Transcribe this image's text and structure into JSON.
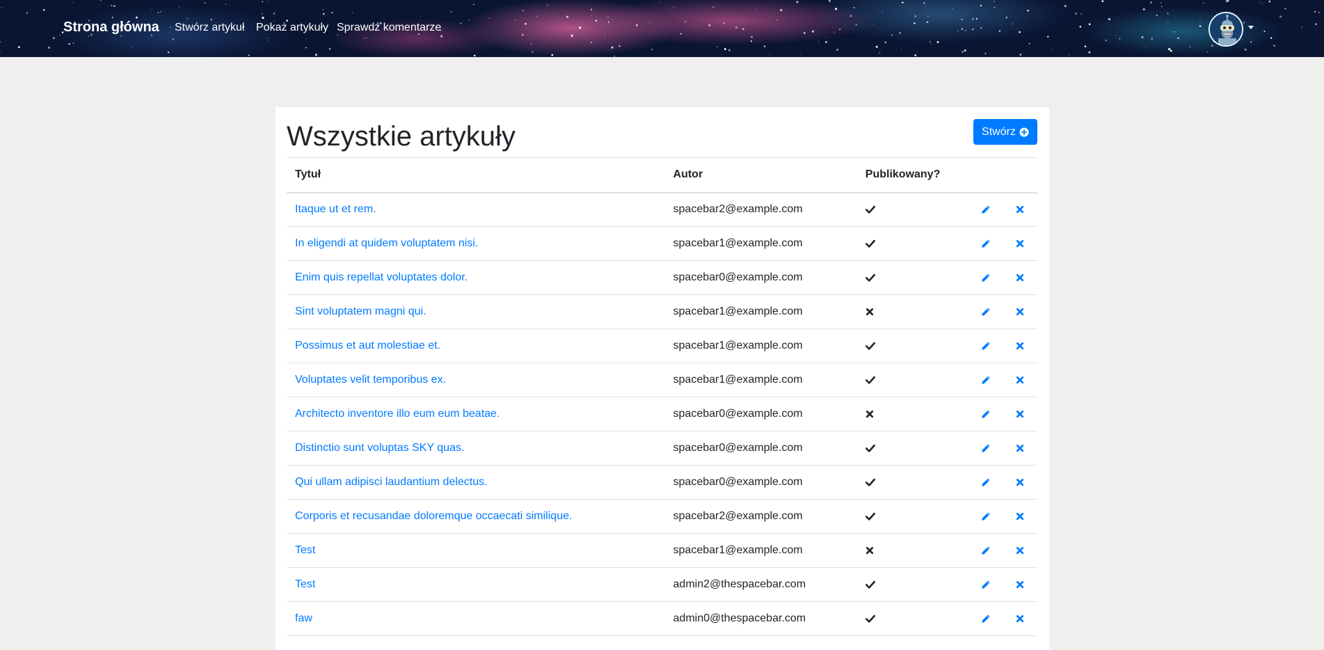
{
  "navbar": {
    "brand": "Strona główna",
    "links": [
      "Stwórz artykuł",
      "Pokaż artykuły",
      "Sprawdź komentarze"
    ]
  },
  "page": {
    "title": "Wszystkie artykuły",
    "create_button": "Stwórz"
  },
  "table": {
    "headers": [
      "Tytuł",
      "Autor",
      "Publikowany?"
    ],
    "rows": [
      {
        "title": "Itaque ut et rem.",
        "author": "spacebar2@example.com",
        "published": true
      },
      {
        "title": "In eligendi at quidem voluptatem nisi.",
        "author": "spacebar1@example.com",
        "published": true
      },
      {
        "title": "Enim quis repellat voluptates dolor.",
        "author": "spacebar0@example.com",
        "published": true
      },
      {
        "title": "Sint voluptatem magni qui.",
        "author": "spacebar1@example.com",
        "published": false
      },
      {
        "title": "Possimus et aut molestiae et.",
        "author": "spacebar1@example.com",
        "published": true
      },
      {
        "title": "Voluptates velit temporibus ex.",
        "author": "spacebar1@example.com",
        "published": true
      },
      {
        "title": "Architecto inventore illo eum eum beatae.",
        "author": "spacebar0@example.com",
        "published": false
      },
      {
        "title": "Distinctio sunt voluptas SKY quas.",
        "author": "spacebar0@example.com",
        "published": true
      },
      {
        "title": "Qui ullam adipisci laudantium delectus.",
        "author": "spacebar0@example.com",
        "published": true
      },
      {
        "title": "Corporis et recusandae doloremque occaecati similique.",
        "author": "spacebar2@example.com",
        "published": true
      },
      {
        "title": "Test",
        "author": "spacebar1@example.com",
        "published": false
      },
      {
        "title": "Test",
        "author": "admin2@thespacebar.com",
        "published": true
      },
      {
        "title": "faw",
        "author": "admin0@thespacebar.com",
        "published": true
      }
    ]
  },
  "icons": {
    "published_true": "check-icon",
    "published_false": "cross-icon",
    "edit": "pencil-icon",
    "delete": "times-icon",
    "create": "plus-circle-icon"
  },
  "colors": {
    "link": "#007bff",
    "button": "#007bff",
    "background": "#efefee"
  }
}
